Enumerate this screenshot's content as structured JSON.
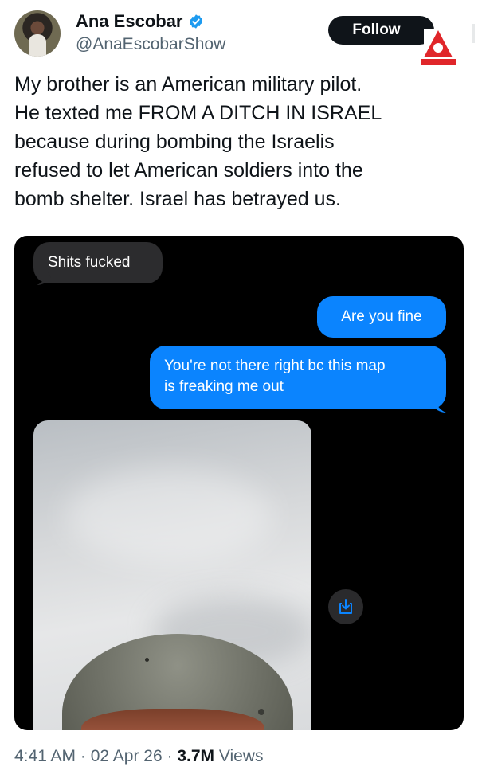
{
  "author": {
    "display_name": "Ana Escobar",
    "handle": "@AnaEscobarShow",
    "verified": true
  },
  "follow_button": {
    "label": "Follow"
  },
  "tweet": {
    "text": "My brother is an American military pilot.\nHe texted me FROM A DITCH IN ISRAEL\nbecause during bombing the Israelis\nrefused to let American soldiers into the\nbomb shelter. Israel has betrayed us."
  },
  "media": {
    "messages": [
      {
        "direction": "incoming",
        "text": "Shits fucked"
      },
      {
        "direction": "outgoing",
        "text": "Are you fine"
      },
      {
        "direction": "outgoing",
        "text": "You're not there right bc this map\nis freaking me out"
      }
    ],
    "save_icon": "save-download-icon"
  },
  "meta": {
    "time": "4:41 AM",
    "sep1": " · ",
    "date": "02 Apr 26",
    "sep2": " · ",
    "views_count": "3.7M",
    "views_label": " Views"
  },
  "colors": {
    "follow_bg": "#0f1419",
    "verified": "#1d9bf0",
    "imessage_blue": "#0b84fe",
    "incoming_gray": "#2c2c2e",
    "logo_red": "#e0262a"
  }
}
